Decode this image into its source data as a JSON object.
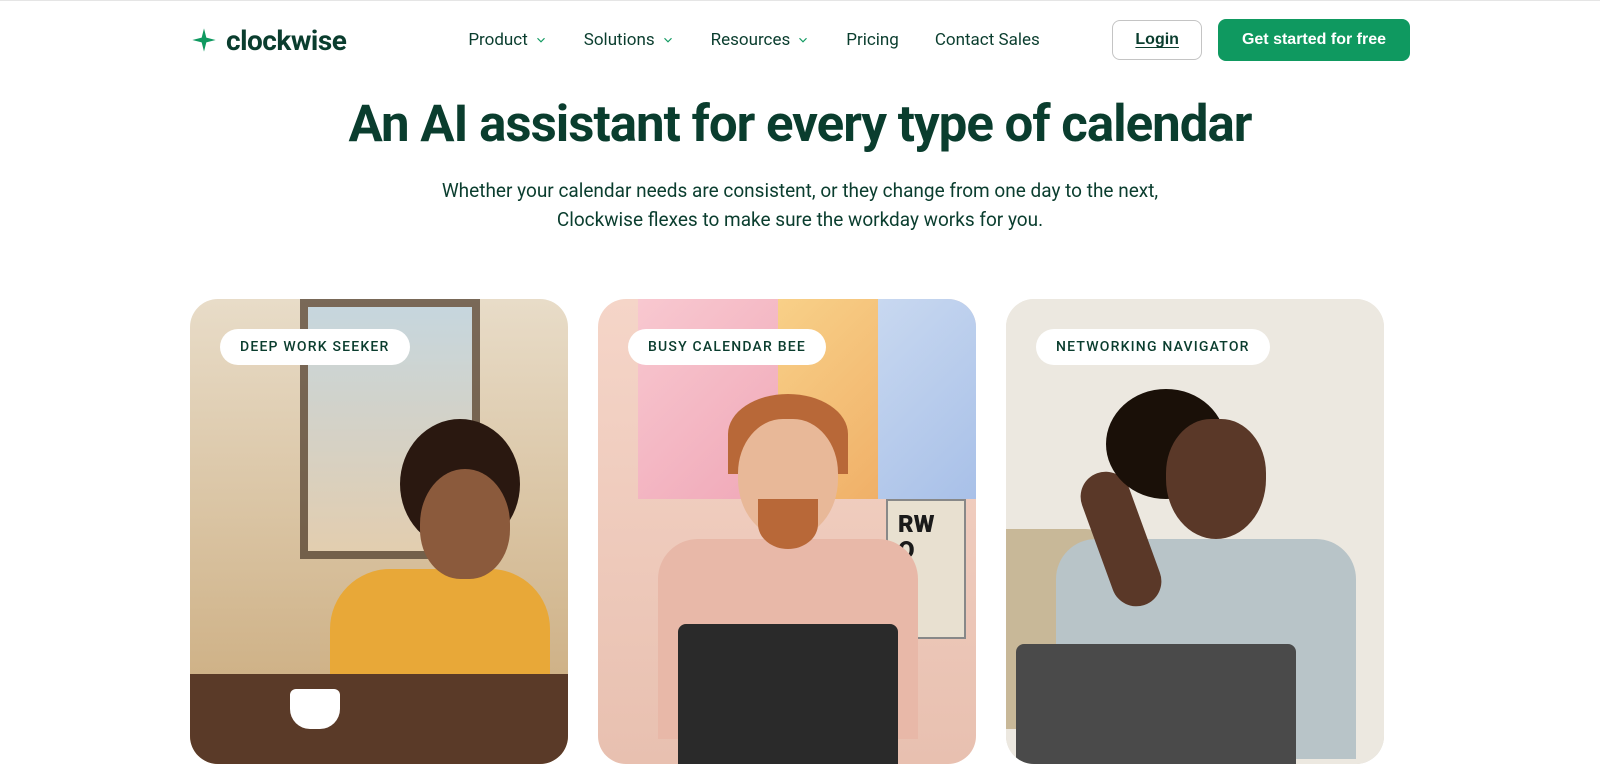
{
  "brand": {
    "name": "clockwise"
  },
  "nav": {
    "items": [
      {
        "label": "Product",
        "hasDropdown": true
      },
      {
        "label": "Solutions",
        "hasDropdown": true
      },
      {
        "label": "Resources",
        "hasDropdown": true
      },
      {
        "label": "Pricing",
        "hasDropdown": false
      },
      {
        "label": "Contact Sales",
        "hasDropdown": false
      }
    ],
    "login": "Login",
    "cta": "Get started for free"
  },
  "hero": {
    "title": "An AI assistant for every type of calendar",
    "subtitle_line1": "Whether your calendar needs are consistent, or they change from one day to the next,",
    "subtitle_line2": "Clockwise flexes to make sure the workday works for you."
  },
  "cards": [
    {
      "badge": "DEEP WORK SEEKER"
    },
    {
      "badge": "BUSY CALENDAR BEE"
    },
    {
      "badge": "NETWORKING NAVIGATOR"
    }
  ],
  "card2_poster": {
    "line1": "RW",
    "line2": "O"
  },
  "colors": {
    "primary": "#0f9960",
    "text": "#0a3d2e"
  }
}
